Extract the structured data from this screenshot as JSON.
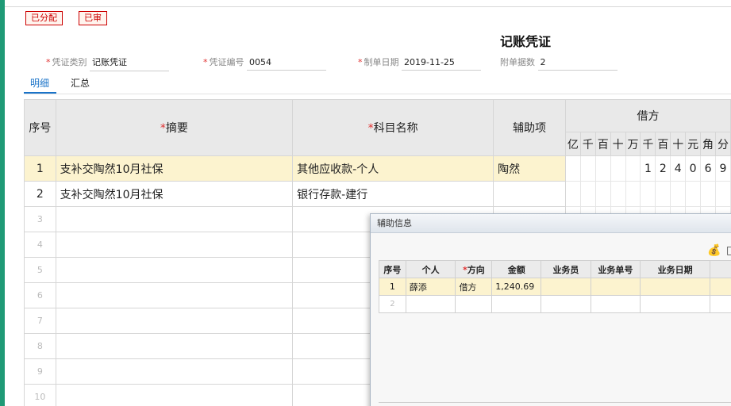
{
  "status_badges": [
    "已分配",
    "已审"
  ],
  "voucher": {
    "title": "记账凭证",
    "type_label": "凭证类别",
    "type_value": "记账凭证",
    "number_label": "凭证编号",
    "number_value": "0054",
    "date_label": "制单日期",
    "date_value": "2019-11-25",
    "attachments_label": "附单据数",
    "attachments_value": "2"
  },
  "tabs": [
    {
      "label": "明细",
      "active": true
    },
    {
      "label": "汇总",
      "active": false
    }
  ],
  "grid": {
    "headers": {
      "seq": "序号",
      "summary": "摘要",
      "account": "科目名称",
      "aux": "辅助项",
      "debit": "借方",
      "required_mark": "*"
    },
    "digit_headers": [
      "亿",
      "千",
      "百",
      "十",
      "万",
      "千",
      "百",
      "十",
      "元",
      "角",
      "分"
    ],
    "rows": [
      {
        "seq": "1",
        "summary": "支补交陶然10月社保",
        "account": "其他应收款-个人",
        "aux": "陶然",
        "digits": [
          "",
          "",
          "",
          "",
          "",
          "1",
          "2",
          "4",
          "0",
          "6",
          "9"
        ]
      },
      {
        "seq": "2",
        "summary": "支补交陶然10月社保",
        "account": "银行存款-建行",
        "aux": "",
        "digits": [
          "",
          "",
          "",
          "",
          "",
          "",
          "",
          "",
          "",
          "",
          ""
        ]
      },
      {
        "seq": "3"
      },
      {
        "seq": "4"
      },
      {
        "seq": "5"
      },
      {
        "seq": "6"
      },
      {
        "seq": "7"
      },
      {
        "seq": "8"
      },
      {
        "seq": "9"
      },
      {
        "seq": "10"
      }
    ]
  },
  "aux_dialog": {
    "title": "辅助信息",
    "toolbar_icons": [
      "money-bag-icon",
      "panel-icon"
    ],
    "headers": [
      "序号",
      "个人",
      "方向",
      "金额",
      "业务员",
      "业务单号",
      "业务日期"
    ],
    "required_mark": "*",
    "rows": [
      {
        "seq": "1",
        "person": "薛添",
        "direction": "借方",
        "amount": "1,240.69",
        "salesman": "",
        "doc_no": "",
        "date": ""
      },
      {
        "seq": "2",
        "person": "",
        "direction": "",
        "amount": "",
        "salesman": "",
        "doc_no": "",
        "date": ""
      }
    ]
  }
}
